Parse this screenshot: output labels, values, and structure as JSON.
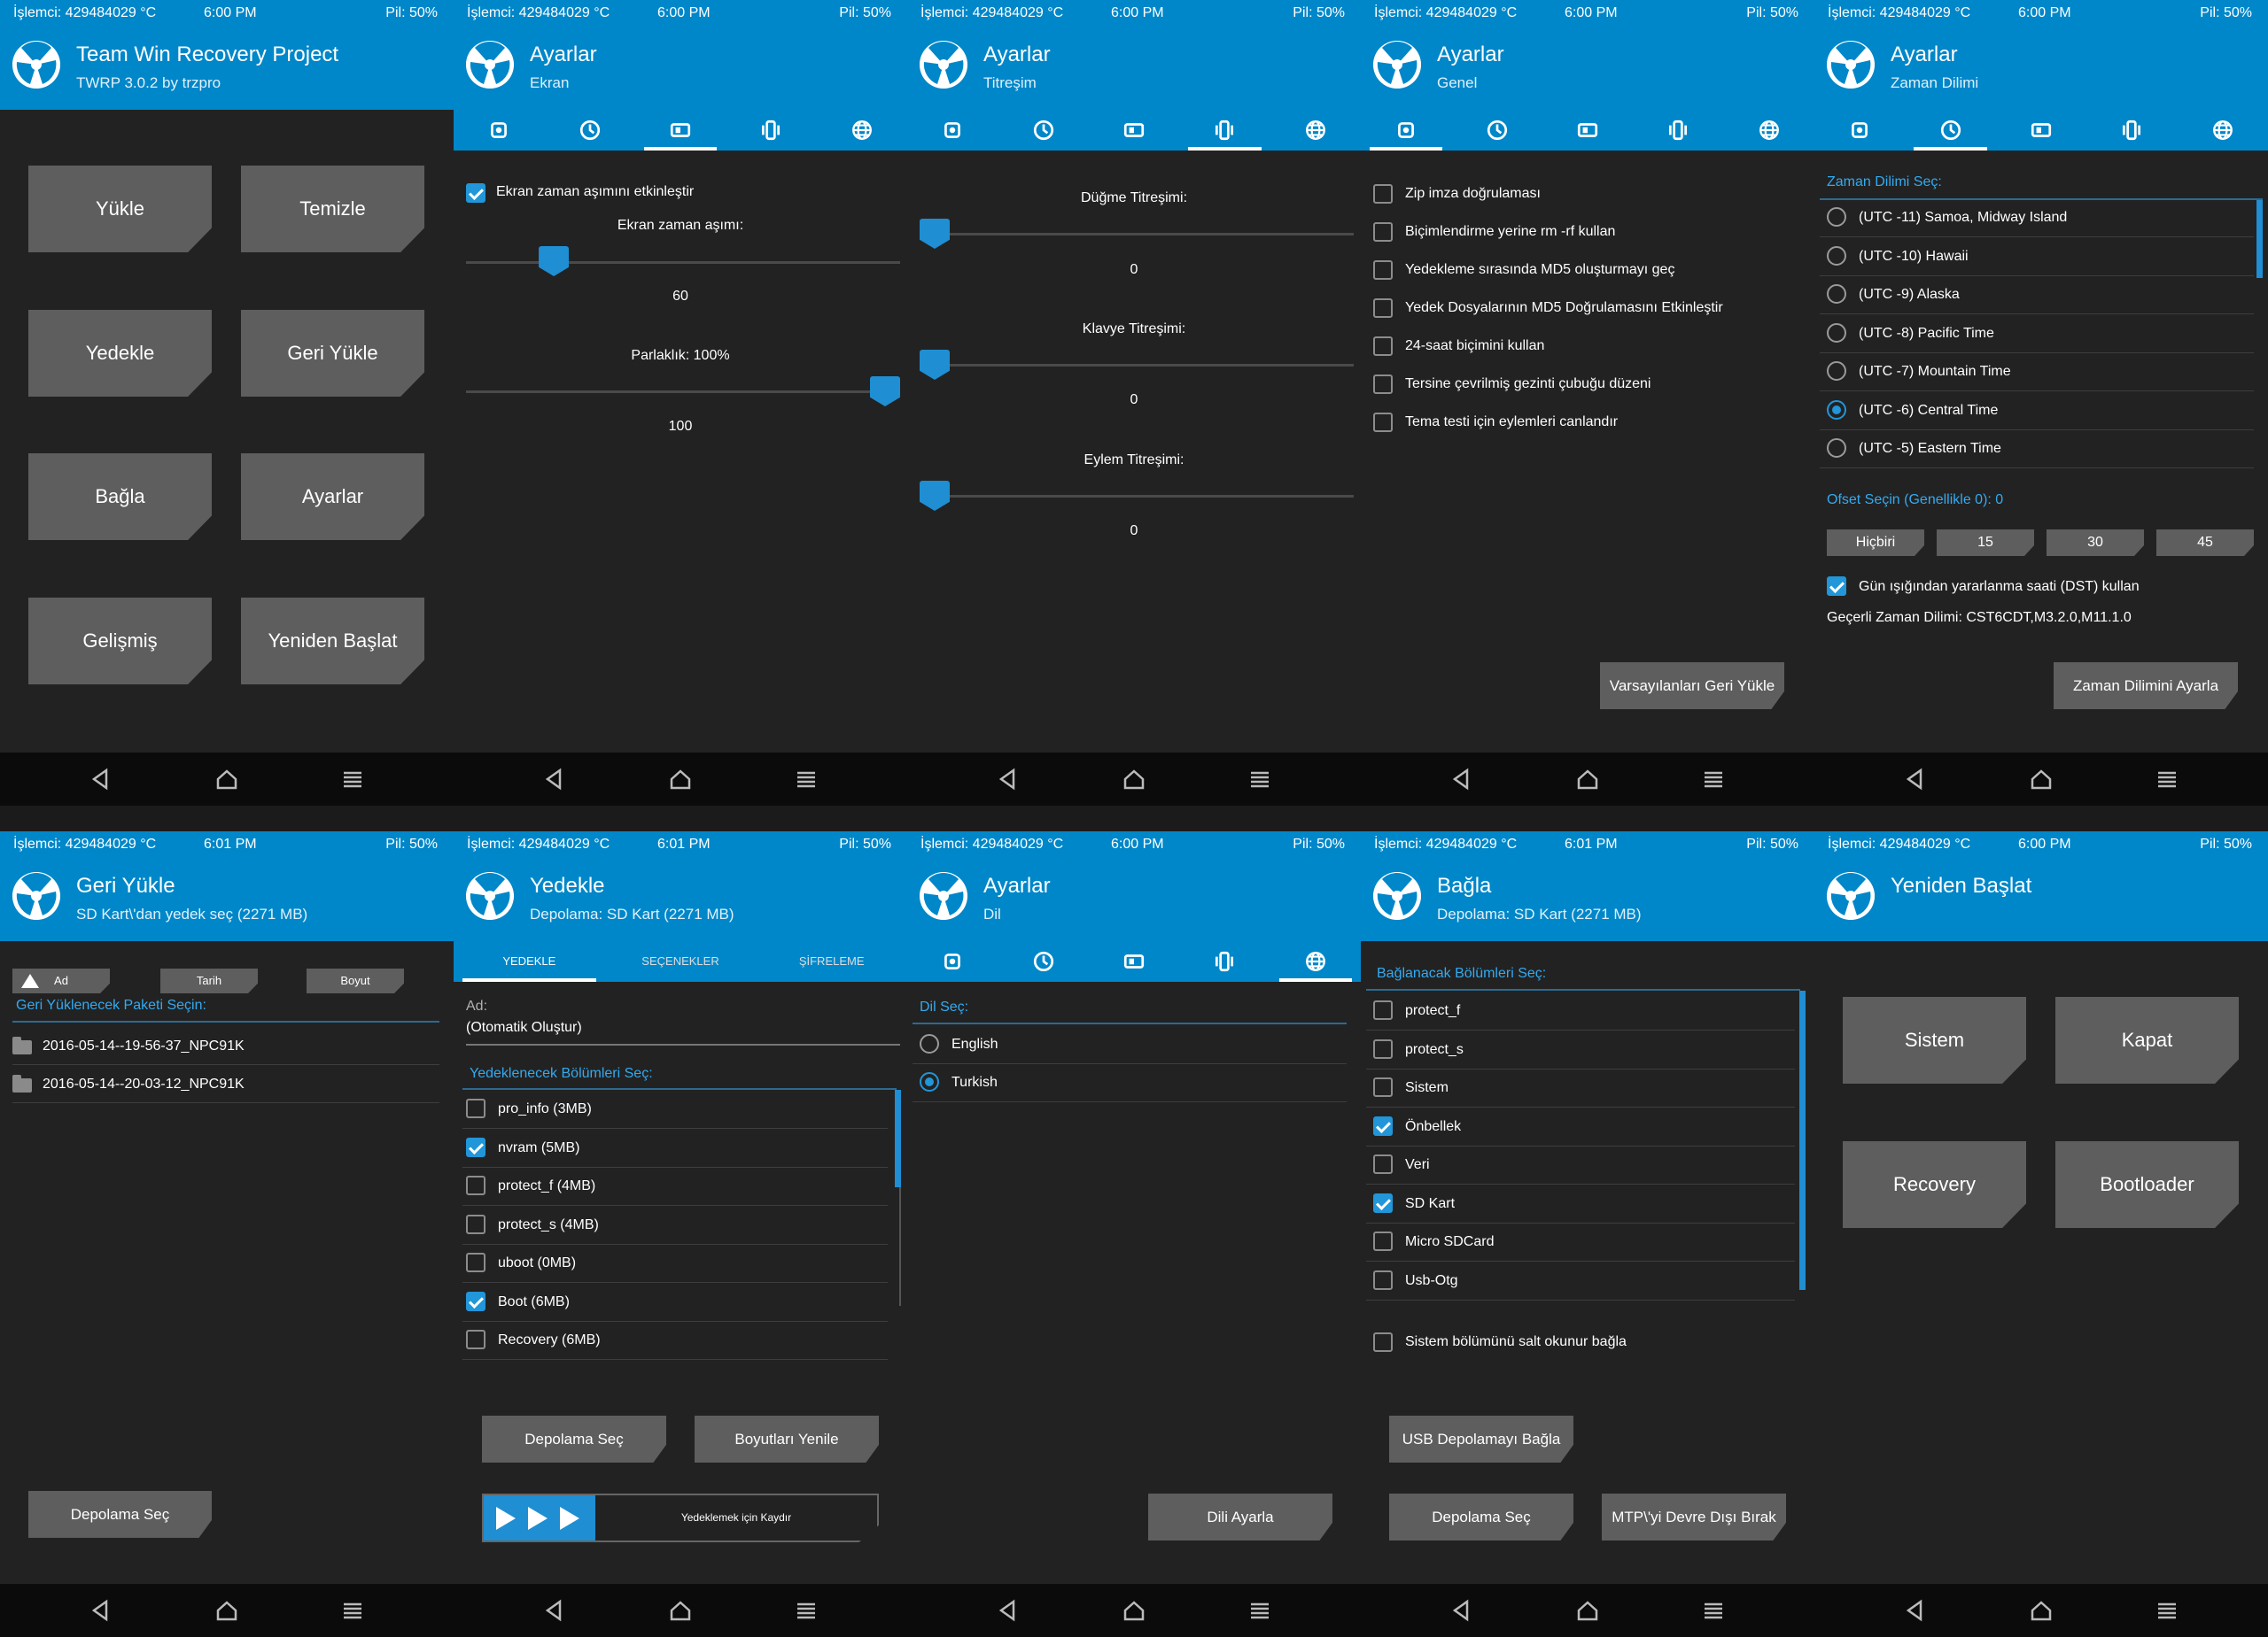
{
  "status": {
    "cpu": "İşlemci: 429484029 °C",
    "battery": "Pil: 50%"
  },
  "screens": [
    {
      "id": "main",
      "time": "6:00 PM",
      "title": "Team Win Recovery Project",
      "subtitle": "TWRP 3.0.2 by trzpro",
      "buttons": [
        "Yükle",
        "Temizle",
        "Yedekle",
        "Geri Yükle",
        "Bağla",
        "Ayarlar",
        "Gelişmiş",
        "Yeniden Başlat"
      ]
    },
    {
      "id": "settings-screen",
      "time": "6:00 PM",
      "title": "Ayarlar",
      "subtitle": "Ekran",
      "active_tab": 2,
      "timeout_checkbox": "Ekran zaman aşımını etkinleştir",
      "timeout_checked": true,
      "timeout_label": "Ekran zaman aşımı:",
      "timeout_value": "60",
      "timeout_fraction": 0.18,
      "brightness_label": "Parlaklık: 100%",
      "brightness_value": "100",
      "brightness_fraction": 1.0
    },
    {
      "id": "settings-vibration",
      "time": "6:00 PM",
      "title": "Ayarlar",
      "subtitle": "Titreşim",
      "active_tab": 3,
      "sliders": [
        {
          "label": "Düğme Titreşimi:",
          "value": "0"
        },
        {
          "label": "Klavye Titreşimi:",
          "value": "0"
        },
        {
          "label": "Eylem Titreşimi:",
          "value": "0"
        }
      ]
    },
    {
      "id": "settings-general",
      "time": "6:00 PM",
      "title": "Ayarlar",
      "subtitle": "Genel",
      "active_tab": 0,
      "options": [
        "Zip imza doğrulaması",
        "Biçimlendirme yerine rm -rf kullan",
        "Yedekleme sırasında MD5 oluşturmayı geç",
        "Yedek Dosyalarının MD5 Doğrulamasını Etkinleştir",
        "24-saat biçimini kullan",
        "Tersine çevrilmiş gezinti çubuğu düzeni",
        "Tema testi için eylemleri canlandır"
      ],
      "restore_button": "Varsayılanları Geri Yükle"
    },
    {
      "id": "settings-timezone",
      "time": "6:00 PM",
      "title": "Ayarlar",
      "subtitle": "Zaman Dilimi",
      "active_tab": 1,
      "select_label": "Zaman Dilimi Seç:",
      "zones": [
        "(UTC -11) Samoa, Midway Island",
        "(UTC -10) Hawaii",
        "(UTC -9) Alaska",
        "(UTC -8) Pacific Time",
        "(UTC -7) Mountain Time",
        "(UTC -6) Central Time",
        "(UTC -5) Eastern Time"
      ],
      "selected_zone": 5,
      "offset_label": "Ofset Seçin (Genellikle 0): 0",
      "offsets": [
        "Hiçbiri",
        "15",
        "30",
        "45"
      ],
      "dst_label": "Gün ışığından yararlanma saati (DST) kullan",
      "dst_checked": true,
      "current_zone": "Geçerli Zaman Dilimi: CST6CDT,M3.2.0,M11.1.0",
      "set_button": "Zaman Dilimini Ayarla"
    },
    {
      "id": "restore",
      "time": "6:01 PM",
      "title": "Geri Yükle",
      "subtitle": "SD Kart\\'dan yedek seç (2271 MB)",
      "sort": [
        "Ad",
        "Tarih",
        "Boyut"
      ],
      "select_label": "Geri Yüklenecek Paketi Seçin:",
      "folders": [
        "2016-05-14--19-56-37_NPC91K",
        "2016-05-14--20-03-12_NPC91K"
      ],
      "storage_button": "Depolama Seç"
    },
    {
      "id": "backup",
      "time": "6:01 PM",
      "title": "Yedekle",
      "subtitle": "Depolama: SD Kart (2271 MB)",
      "tabs": [
        "YEDEKLE",
        "SEÇENEKLER",
        "ŞİFRELEME"
      ],
      "name_label": "Ad:",
      "name_value": "(Otomatik Oluştur)",
      "parts_label": "Yedeklenecek Bölümleri Seç:",
      "partitions": [
        {
          "name": "pro_info (3MB)",
          "checked": false
        },
        {
          "name": "nvram (5MB)",
          "checked": true
        },
        {
          "name": "protect_f (4MB)",
          "checked": false
        },
        {
          "name": "protect_s (4MB)",
          "checked": false
        },
        {
          "name": "uboot (0MB)",
          "checked": false
        },
        {
          "name": "Boot (6MB)",
          "checked": true
        },
        {
          "name": "Recovery (6MB)",
          "checked": false
        }
      ],
      "storage_button": "Depolama Seç",
      "refresh_button": "Boyutları Yenile",
      "swipe_label": "Yedeklemek için Kaydır"
    },
    {
      "id": "settings-language",
      "time": "6:00 PM",
      "title": "Ayarlar",
      "subtitle": "Dil",
      "active_tab": 4,
      "select_label": "Dil Seç:",
      "languages": [
        "English",
        "Turkish"
      ],
      "selected_language": 1,
      "set_button": "Dili Ayarla"
    },
    {
      "id": "mount",
      "time": "6:01 PM",
      "title": "Bağla",
      "subtitle": "Depolama: SD Kart (2271 MB)",
      "select_label": "Bağlanacak Bölümleri Seç:",
      "partitions": [
        {
          "name": "protect_f",
          "checked": false
        },
        {
          "name": "protect_s",
          "checked": false
        },
        {
          "name": "Sistem",
          "checked": false
        },
        {
          "name": "Önbellek",
          "checked": true
        },
        {
          "name": "Veri",
          "checked": false
        },
        {
          "name": "SD Kart",
          "checked": true
        },
        {
          "name": "Micro SDCard",
          "checked": false
        },
        {
          "name": "Usb-Otg",
          "checked": false
        }
      ],
      "readonly_label": "Sistem bölümünü salt okunur bağla",
      "usb_button": "USB Depolamayı Bağla",
      "storage_button": "Depolama Seç",
      "mtp_button": "MTP\\'yi Devre Dışı Bırak"
    },
    {
      "id": "reboot",
      "time": "6:00 PM",
      "title": "Yeniden Başlat",
      "subtitle": "",
      "buttons": [
        "Sistem",
        "Kapat",
        "Recovery",
        "Bootloader"
      ]
    }
  ],
  "colors": {
    "accent": "#0087c9",
    "background": "#222222",
    "button": "#5e5e5e",
    "highlight": "#1f8ed3"
  },
  "icons": [
    "twrp-logo-icon",
    "settings-gear-icon",
    "clock-icon",
    "screen-icon",
    "vibration-icon",
    "globe-icon",
    "nav-back-icon",
    "nav-home-icon",
    "nav-menu-icon",
    "folder-icon",
    "checkbox-icon",
    "radio-icon"
  ]
}
